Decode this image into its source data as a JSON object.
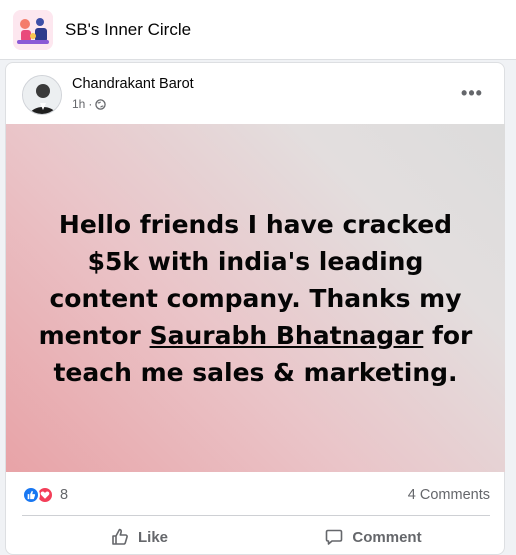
{
  "group": {
    "name": "SB's Inner Circle",
    "logo_icon": "group-illustration-icon"
  },
  "post": {
    "author": "Chandrakant Barot",
    "time": "1h",
    "separator": "·",
    "privacy_icon": "globe-icon",
    "more_label": "•••",
    "text_before_mention": "Hello friends I have cracked $5k with india's leading content company. Thanks my mentor ",
    "mention": "Saurabh Bhatnagar",
    "text_after_mention": " for teach me sales & marketing.",
    "reaction_count": "8",
    "comments_label": "4 Comments",
    "reactions": [
      "like",
      "love"
    ]
  },
  "actions": {
    "like_label": "Like",
    "comment_label": "Comment"
  },
  "colors": {
    "accent": "#1877f2",
    "love": "#f33e58",
    "secondary_text": "#65676b"
  }
}
